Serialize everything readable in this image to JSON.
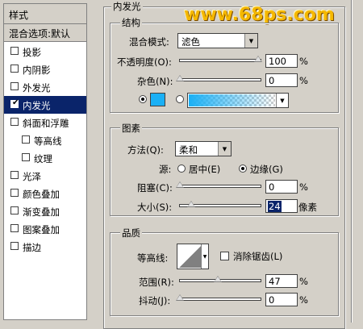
{
  "left_panel": {
    "header": "样式",
    "default_item": "混合选项:默认",
    "items": [
      {
        "label": "投影",
        "checked": false
      },
      {
        "label": "内阴影",
        "checked": false
      },
      {
        "label": "外发光",
        "checked": false
      },
      {
        "label": "内发光",
        "checked": true,
        "selected": true
      },
      {
        "label": "斜面和浮雕",
        "checked": false
      },
      {
        "label": "等高线",
        "checked": false
      },
      {
        "label": "纹理",
        "checked": false
      },
      {
        "label": "光泽",
        "checked": false
      },
      {
        "label": "颜色叠加",
        "checked": false
      },
      {
        "label": "渐变叠加",
        "checked": false
      },
      {
        "label": "图案叠加",
        "checked": false
      },
      {
        "label": "描边",
        "checked": false
      }
    ]
  },
  "panel": {
    "title": "内发光",
    "watermark": "www.68ps.com",
    "structure": {
      "title": "结构",
      "blend_mode_label": "混合模式:",
      "blend_mode_value": "滤色",
      "opacity_label": "不透明度(O):",
      "opacity_value": "100",
      "noise_label": "杂色(N):",
      "noise_value": "0",
      "percent": "%",
      "glow_color": "#1ab0f5"
    },
    "elements": {
      "title": "图素",
      "technique_label": "方法(Q):",
      "technique_value": "柔和",
      "source_label": "源:",
      "source_center": "居中(E)",
      "source_edge": "边缘(G)",
      "choke_label": "阻塞(C):",
      "choke_value": "0",
      "size_label": "大小(S):",
      "size_value": "24",
      "size_unit": "像素",
      "percent": "%"
    },
    "quality": {
      "title": "品质",
      "contour_label": "等高线:",
      "anti_alias_label": "消除锯齿(L)",
      "range_label": "范围(R):",
      "range_value": "47",
      "jitter_label": "抖动(J):",
      "jitter_value": "0",
      "percent": "%"
    }
  }
}
